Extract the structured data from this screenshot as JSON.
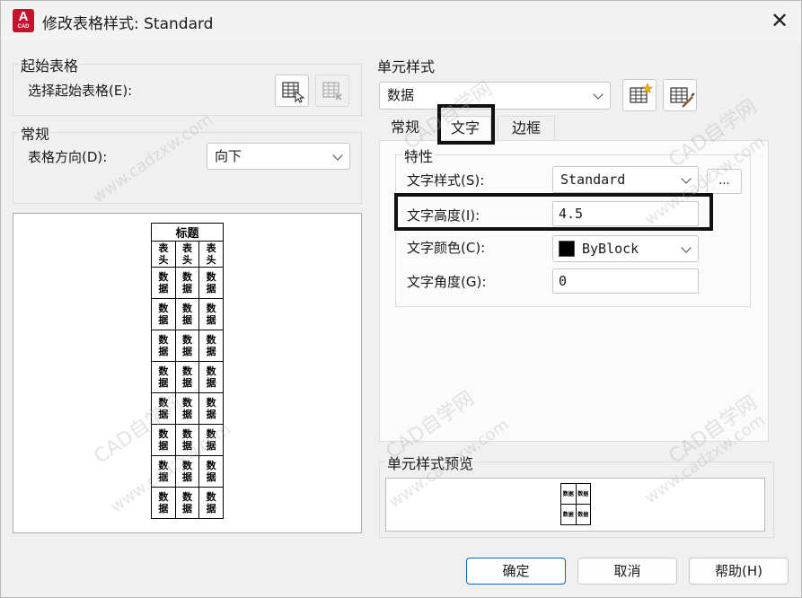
{
  "window": {
    "title": "修改表格样式: Standard",
    "app_icon_letter": "A",
    "app_icon_sub": "CAD"
  },
  "start_table": {
    "group_label": "起始表格",
    "select_label": "选择起始表格(E):"
  },
  "general": {
    "group_label": "常规",
    "direction_label": "表格方向(D):",
    "direction_value": "向下"
  },
  "cell_style": {
    "group_label": "单元样式",
    "selected": "数据",
    "tabs": [
      "常规",
      "文字",
      "边框"
    ],
    "active_tab": 1,
    "properties": {
      "group_label": "特性",
      "text_style_label": "文字样式(S):",
      "text_style_value": "Standard",
      "ellipsis": "...",
      "text_height_label": "文字高度(I):",
      "text_height_value": "4.5",
      "text_color_label": "文字颜色(C):",
      "text_color_value": "ByBlock",
      "text_color_swatch": "#000000",
      "text_angle_label": "文字角度(G):",
      "text_angle_value": "0"
    },
    "preview_label": "单元样式预览",
    "preview_cells": [
      [
        "数据",
        "数据"
      ],
      [
        "数据",
        "数据"
      ]
    ]
  },
  "table_preview": {
    "title": "标题",
    "header": [
      "表头",
      "表头",
      "表头"
    ],
    "cell_text": "数据",
    "rows": 8
  },
  "buttons": {
    "ok": "确定",
    "cancel": "取消",
    "help": "帮助(H)"
  },
  "watermark": [
    "CAD自学网",
    "www.cadzxw.com"
  ]
}
